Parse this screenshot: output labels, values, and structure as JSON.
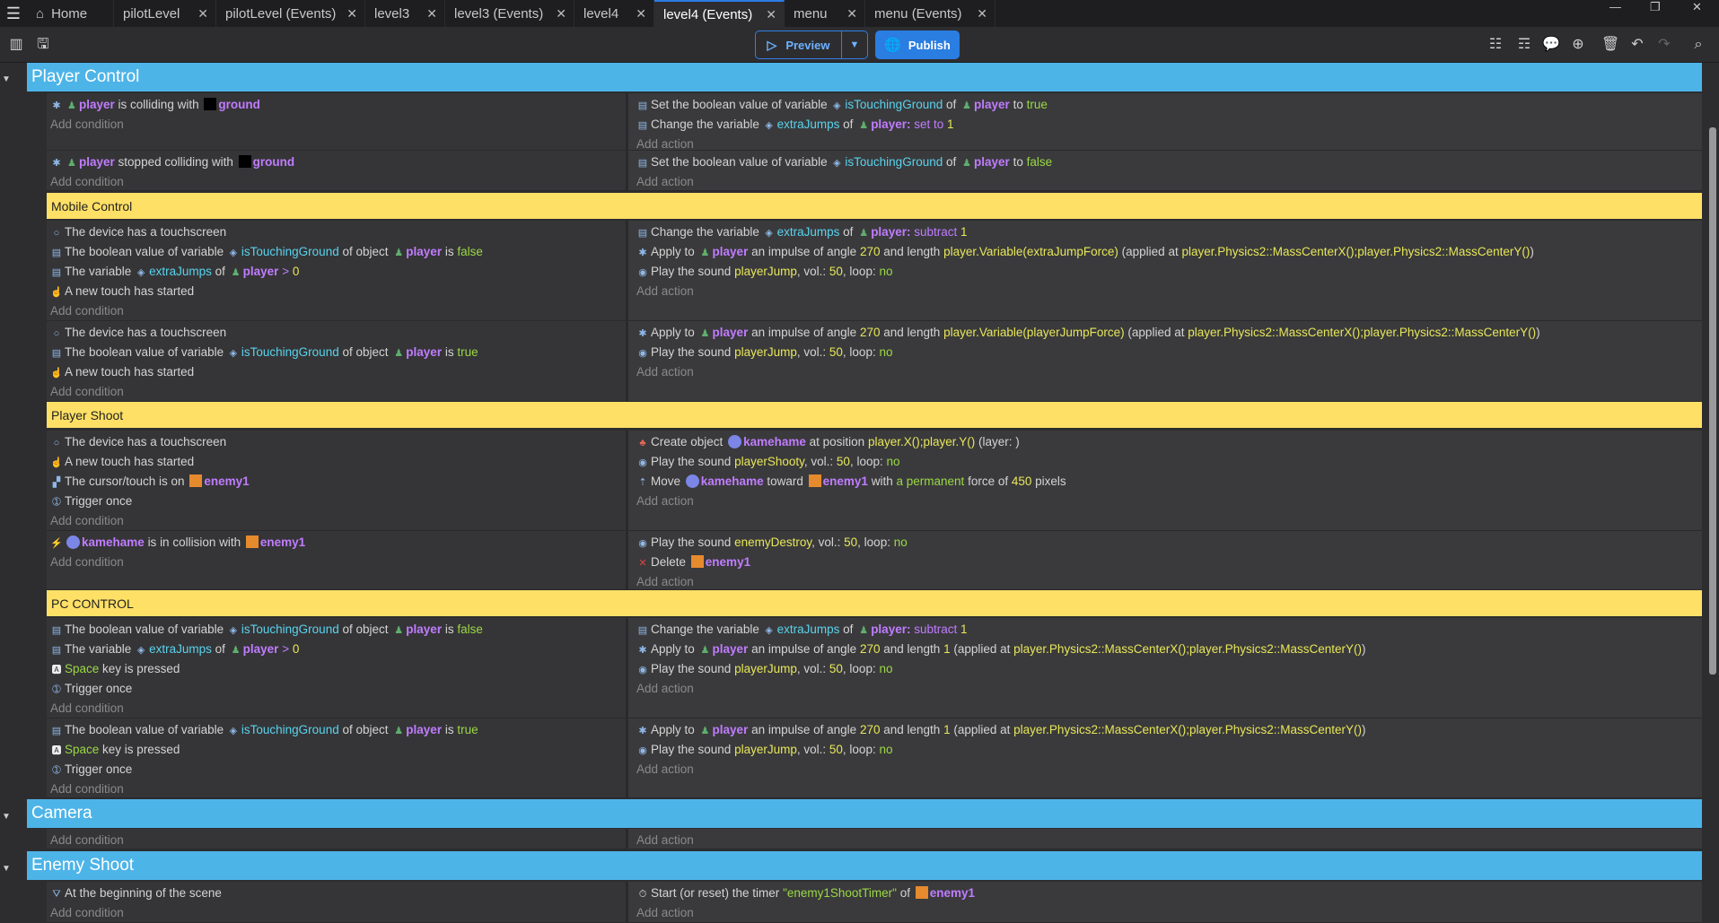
{
  "tabs": [
    {
      "label": "Home",
      "active": false,
      "closable": false
    },
    {
      "label": "pilotLevel",
      "active": false,
      "closable": true
    },
    {
      "label": "pilotLevel (Events)",
      "active": false,
      "closable": true
    },
    {
      "label": "level3",
      "active": false,
      "closable": true
    },
    {
      "label": "level3 (Events)",
      "active": false,
      "closable": true
    },
    {
      "label": "level4",
      "active": false,
      "closable": true
    },
    {
      "label": "level4 (Events)",
      "active": true,
      "closable": true
    },
    {
      "label": "menu",
      "active": false,
      "closable": true
    },
    {
      "label": "menu (Events)",
      "active": false,
      "closable": true
    }
  ],
  "toolbar": {
    "preview_label": "Preview",
    "publish_label": "Publish"
  },
  "labels": {
    "add_condition": "Add condition",
    "add_action": "Add action"
  },
  "groups": {
    "player_control": "Player Control",
    "camera": "Camera",
    "enemy_shoot": "Enemy Shoot"
  },
  "comments": {
    "mobile": "Mobile Control",
    "shoot": "Player Shoot",
    "pc": "PC CONTROL"
  },
  "objects": {
    "player": "player",
    "ground": "ground",
    "enemy1": "enemy1",
    "kamehame": "kamehame"
  },
  "vars": {
    "isTouchingGround": "isTouchingGround",
    "extraJumps": "extraJumps"
  },
  "text": {
    "is_colliding_with": "is colliding with",
    "stopped_colliding_with": "stopped colliding with",
    "set_bool_value": "Set the boolean value of variable",
    "of": "of",
    "to": "to",
    "true": "true",
    "false": "false",
    "change_the_variable": "Change the variable",
    "player_colon": "player:",
    "set_to_1": "set to",
    "one": "1",
    "subtract": "subtract",
    "device_touchscreen": "The device has a touchscreen",
    "bool_value_of_var": "The boolean value of variable",
    "of_object": "of object",
    "is": "is",
    "the_variable": "The variable",
    "gt": ">",
    "zero": "0",
    "new_touch": "A new touch has started",
    "apply_to": "Apply to",
    "impulse_angle": "an impulse of angle",
    "angle_270": "270",
    "and_length": "and length",
    "len_extra": "player.Variable(extraJumpForce)",
    "len_player": "player.Variable(playerJumpForce)",
    "applied_at": "(applied at",
    "mass_center": "player.Physics2::MassCenterX();player.Physics2::MassCenterY()",
    "close_paren": ")",
    "play_sound": "Play the sound",
    "playerJump": "playerJump",
    "playerShooty": "playerShooty",
    "enemyDestroy": "enemyDestroy",
    "vol": ", vol.:",
    "vol_50": "50",
    "loop": ", loop:",
    "no": "no",
    "cursor_on": "The cursor/touch is on",
    "trigger_once": "Trigger once",
    "create_object": "Create object",
    "at_position": "at position",
    "pos_expr": "player.X();player.Y()",
    "layer": "(layer: )",
    "move": "Move",
    "toward": "toward",
    "with": "with",
    "permanent": "a permanent",
    "force_of": "force of",
    "force_450": "450",
    "pixels": "pixels",
    "in_collision_with": "is in collision with",
    "delete": "Delete",
    "space": "Space",
    "key_pressed": "key is pressed",
    "scene_begin": "At the beginning of the scene",
    "start_timer": "Start (or reset) the timer",
    "timer_name": "\"enemy1ShootTimer\""
  }
}
